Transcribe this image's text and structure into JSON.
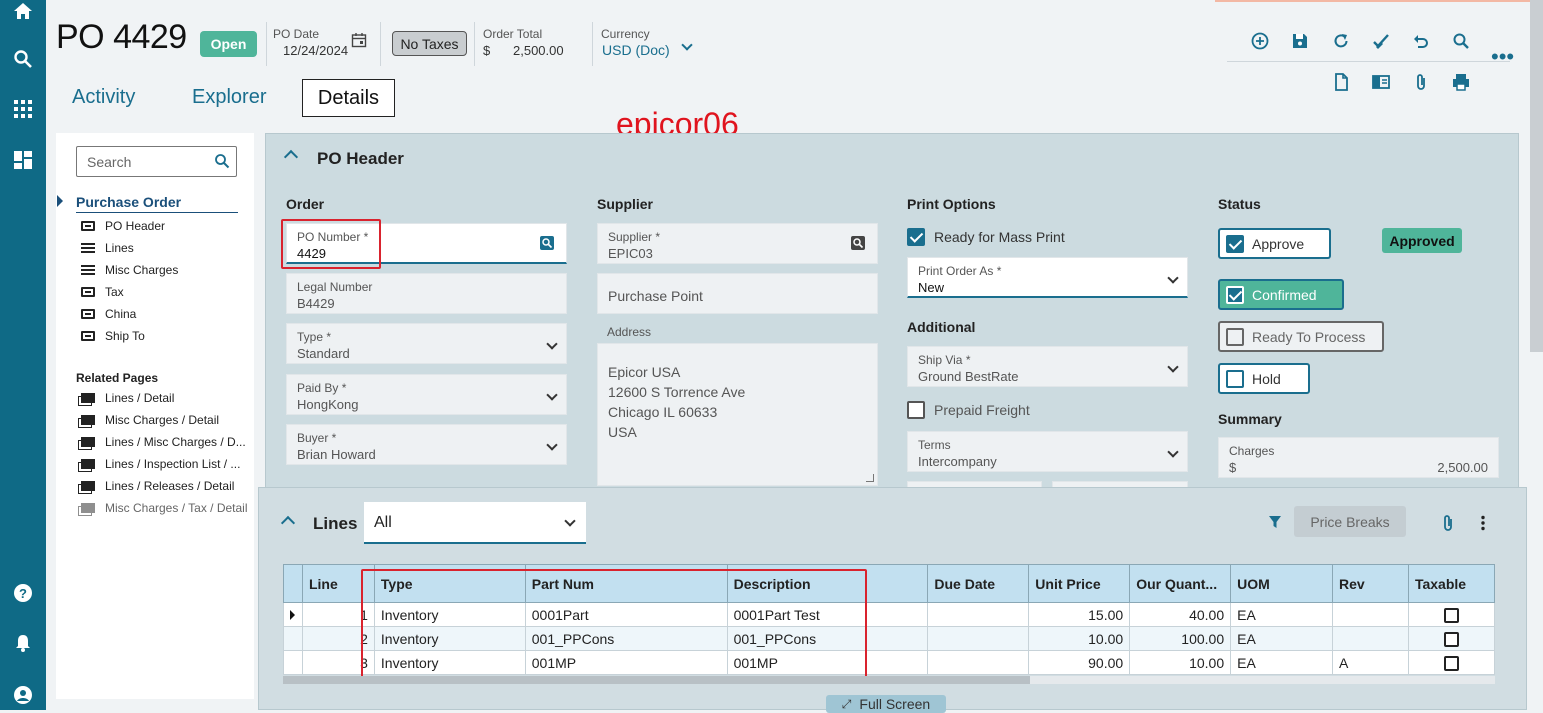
{
  "header": {
    "title": "PO 4429",
    "status": "Open",
    "po_date_label": "PO Date",
    "po_date": "12/24/2024",
    "taxes_btn": "No Taxes",
    "order_total_label": "Order Total",
    "order_total_currency": "$",
    "order_total": "2,500.00",
    "currency_label": "Currency",
    "currency_value": "USD (Doc)"
  },
  "tabs": {
    "activity": "Activity",
    "explorer": "Explorer",
    "details": "Details"
  },
  "watermark": "epicor06",
  "nav": {
    "search_placeholder": "Search",
    "section": "Purchase Order",
    "items": [
      "PO Header",
      "Lines",
      "Misc Charges",
      "Tax",
      "China",
      "Ship To"
    ],
    "related_title": "Related Pages",
    "related": [
      "Lines / Detail",
      "Misc Charges / Detail",
      "Lines / Misc Charges / D...",
      "Lines / Inspection List / ...",
      "Lines / Releases / Detail",
      "Misc Charges / Tax / Detail"
    ]
  },
  "poheader": {
    "title": "PO Header",
    "order": {
      "title": "Order",
      "po_number_label": "PO Number *",
      "po_number": "4429",
      "legal_label": "Legal Number",
      "legal": "B4429",
      "type_label": "Type *",
      "type": "Standard",
      "paidby_label": "Paid By *",
      "paidby": "HongKong",
      "buyer_label": "Buyer *",
      "buyer": "Brian Howard"
    },
    "supplier": {
      "title": "Supplier",
      "supplier_label": "Supplier *",
      "supplier": "EPIC03",
      "purchase_point": "Purchase Point",
      "address_label": "Address",
      "address": [
        "Epicor USA",
        "12600 S Torrence Ave",
        "Chicago IL 60633",
        "USA"
      ]
    },
    "print": {
      "title": "Print Options",
      "mass_print": "Ready for Mass Print",
      "print_as_label": "Print Order As *",
      "print_as": "New",
      "additional": "Additional",
      "shipvia_label": "Ship Via *",
      "shipvia": "Ground BestRate",
      "prepaid": "Prepaid Freight",
      "terms_label": "Terms",
      "terms": "Intercompany"
    },
    "status": {
      "title": "Status",
      "approve": "Approve",
      "approved_badge": "Approved",
      "confirmed": "Confirmed",
      "ready": "Ready To Process",
      "hold": "Hold",
      "summary": "Summary",
      "charges_label": "Charges",
      "charges_currency": "$",
      "charges": "2,500.00"
    }
  },
  "lines": {
    "title": "Lines",
    "filter": "All",
    "price_breaks": "Price Breaks",
    "full_screen": "Full Screen",
    "columns": [
      "Line",
      "Type",
      "Part Num",
      "Description",
      "Due Date",
      "Unit Price",
      "Our Quant...",
      "UOM",
      "Rev",
      "Taxable"
    ],
    "rows": [
      [
        "1",
        "Inventory",
        "0001Part",
        "0001Part Test",
        "",
        "15.00",
        "40.00",
        "EA",
        ""
      ],
      [
        "2",
        "Inventory",
        "001_PPCons",
        "001_PPCons",
        "",
        "10.00",
        "100.00",
        "EA",
        ""
      ],
      [
        "3",
        "Inventory",
        "001MP",
        "001MP",
        "",
        "90.00",
        "10.00",
        "EA",
        "A"
      ]
    ]
  },
  "colors": {
    "rail": "#0f6a86",
    "accent": "#1a6e8e",
    "status_green": "#4fb59a",
    "panel": "#ccdbe0",
    "highlight_red": "#d9232e"
  }
}
